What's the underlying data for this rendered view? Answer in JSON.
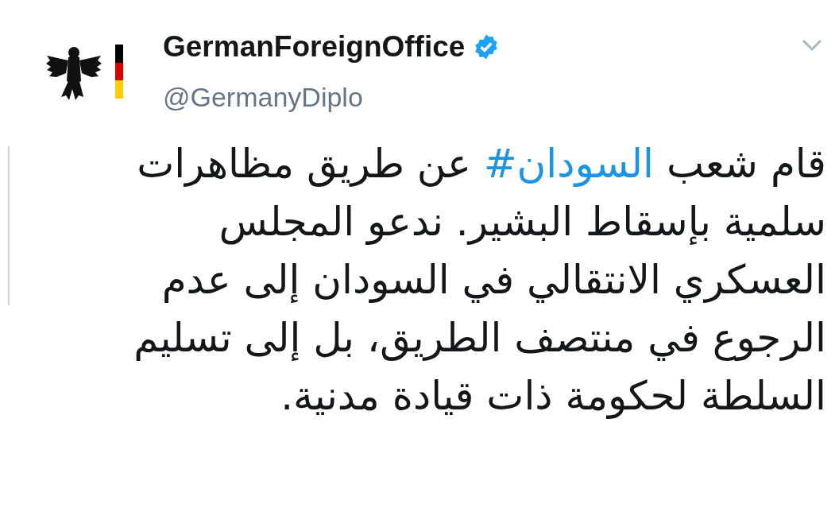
{
  "author": {
    "name": "GermanForeignOffice",
    "verified": true,
    "handle": "@GermanyDiplo"
  },
  "tweet": {
    "parts": [
      {
        "kind": "text",
        "text": "قام شعب "
      },
      {
        "kind": "hashtag",
        "text": "#السودان"
      },
      {
        "kind": "text",
        "text": " عن طريق مظاهرات سلمية بإسقاط البشير. ندعو المجلس العسكري الانتقالي في السودان إلى عدم الرجوع في منتصف الطريق، بل إلى تسليم السلطة لحكومة ذات قيادة مدنية."
      }
    ]
  }
}
